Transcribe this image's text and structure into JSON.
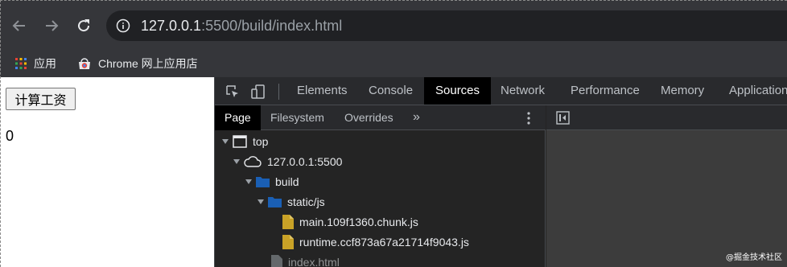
{
  "browser": {
    "url_host": "127.0.0.1",
    "url_rest": ":5500/build/index.html",
    "icons": {
      "back": "arrow-left-icon",
      "forward": "arrow-right-icon",
      "reload": "reload-icon",
      "info": "info-icon"
    },
    "bookmarks": [
      {
        "label": "应用",
        "icon": "apps-grid-icon"
      },
      {
        "label": "Chrome 网上应用店",
        "icon": "chrome-store-icon"
      }
    ]
  },
  "page": {
    "button_label": "计算工资",
    "result": "0"
  },
  "devtools": {
    "tabs": [
      "Elements",
      "Console",
      "Sources",
      "Network",
      "Performance",
      "Memory",
      "Application"
    ],
    "active_tab": "Sources",
    "navigator_tabs": [
      "Page",
      "Filesystem",
      "Overrides"
    ],
    "active_navigator_tab": "Page",
    "more_tabs_glyph": "»",
    "tree": [
      {
        "label": "top",
        "icon": "frame-icon",
        "expanded": true
      },
      {
        "label": "127.0.0.1:5500",
        "icon": "cloud-icon",
        "expanded": true
      },
      {
        "label": "build",
        "icon": "folder-icon",
        "expanded": true
      },
      {
        "label": "static/js",
        "icon": "folder-icon",
        "expanded": true
      },
      {
        "label": "main.109f1360.chunk.js",
        "icon": "js-file-icon"
      },
      {
        "label": "runtime.ccf873a67a21714f9043.js",
        "icon": "js-file-icon"
      },
      {
        "label": "index.html",
        "icon": "file-icon"
      }
    ]
  },
  "watermark": "@掘金技术社区",
  "colors": {
    "toolbar": "#35363a",
    "omnibox": "#202124",
    "devtools_bg": "#242424",
    "active_tab": "#000000",
    "folder": "#1a5fb4",
    "js_file": "#c9a227"
  }
}
